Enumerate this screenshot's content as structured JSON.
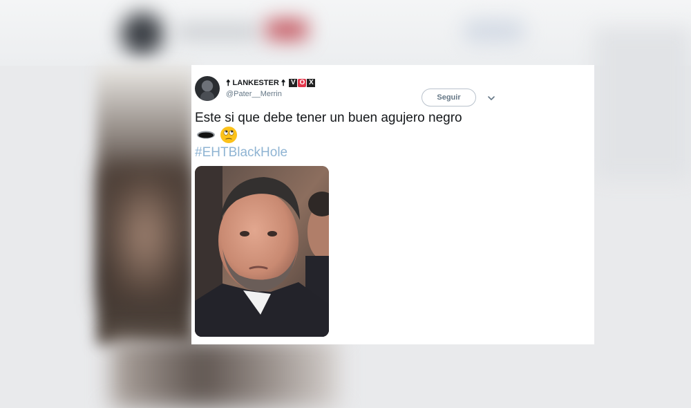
{
  "tweet": {
    "display_name": "LANKESTER",
    "name_symbols": [
      "☨",
      "☨"
    ],
    "vox_letters": [
      "V",
      "O",
      "X"
    ],
    "handle": "@Pater__Merrin",
    "follow_label": "Seguir",
    "text": "Este si que debe tener un buen agujero negro",
    "emojis": [
      "hole-icon",
      "face-with-rolling-eyes-icon"
    ],
    "hashtag": "#EHTBlackHole"
  },
  "colors": {
    "text": "#14171a",
    "secondary": "#657786",
    "hashtag": "#8fb4d3",
    "vox_red": "#e2364a"
  }
}
